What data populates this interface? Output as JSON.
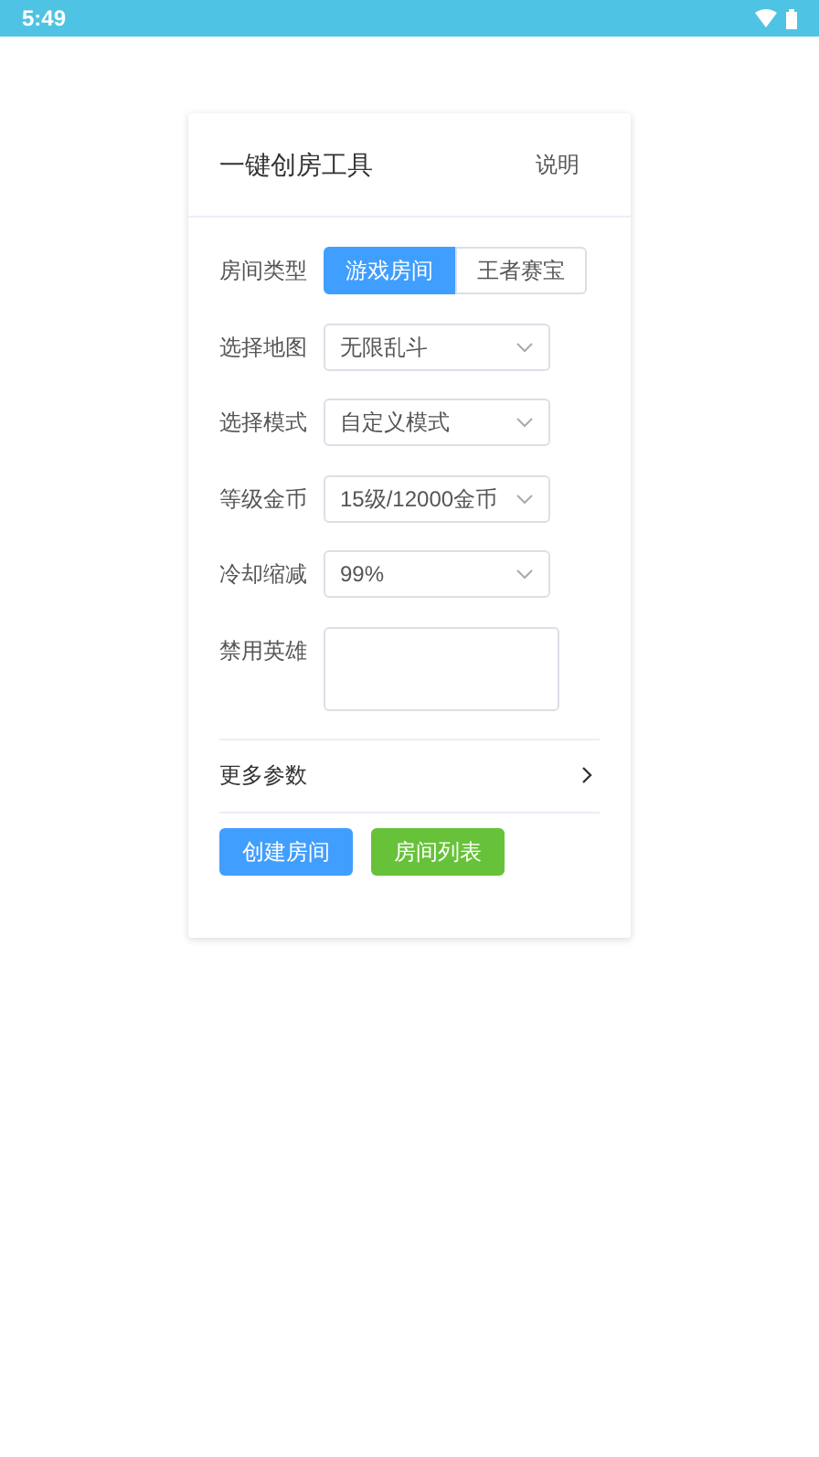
{
  "status_bar": {
    "time": "5:49"
  },
  "card": {
    "title": "一键创房工具",
    "help_link": "说明"
  },
  "room_type": {
    "label": "房间类型",
    "options": [
      {
        "label": "游戏房间",
        "selected": true
      },
      {
        "label": "王者赛宝",
        "selected": false
      }
    ]
  },
  "fields": [
    {
      "kind": "select",
      "label": "选择地图",
      "value": "无限乱斗"
    },
    {
      "kind": "select",
      "label": "选择模式",
      "value": "自定义模式"
    },
    {
      "kind": "select",
      "label": "等级金币",
      "value": "15级/12000金币"
    },
    {
      "kind": "select",
      "label": "冷却缩减",
      "value": "99%"
    },
    {
      "kind": "textarea",
      "label": "禁用英雄"
    }
  ],
  "more_params": {
    "label": "更多参数"
  },
  "buttons": [
    {
      "label": "创建房间",
      "color": "#409eff"
    },
    {
      "label": "房间列表",
      "color": "#67c23a"
    }
  ]
}
